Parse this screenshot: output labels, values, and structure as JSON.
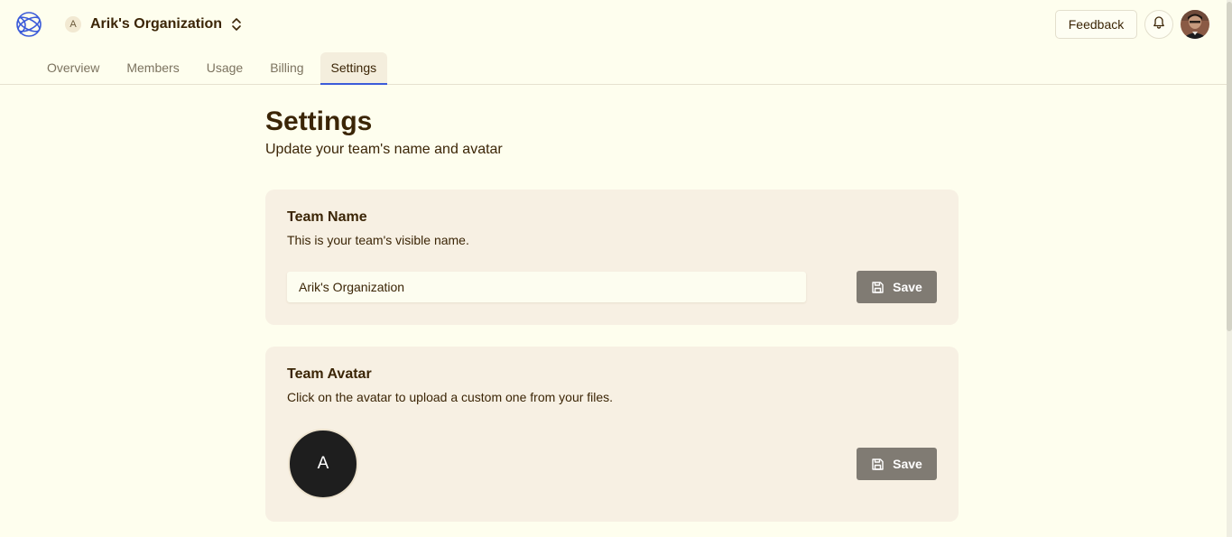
{
  "header": {
    "org_badge": "A",
    "org_name": "Arik's Organization",
    "feedback_label": "Feedback"
  },
  "tabs": [
    {
      "label": "Overview"
    },
    {
      "label": "Members"
    },
    {
      "label": "Usage"
    },
    {
      "label": "Billing"
    },
    {
      "label": "Settings"
    }
  ],
  "active_tab": "Settings",
  "page": {
    "title": "Settings",
    "subtitle": "Update your team's name and avatar"
  },
  "team_name_card": {
    "title": "Team Name",
    "description": "This is your team's visible name.",
    "input_value": "Arik's Organization",
    "save_label": "Save"
  },
  "team_avatar_card": {
    "title": "Team Avatar",
    "description": "Click on the avatar to upload a custom one from your files.",
    "avatar_letter": "A",
    "save_label": "Save"
  },
  "icons": {
    "logo": "globe-logo-icon",
    "org_switcher": "chevron-up-down-icon",
    "notifications": "bell-icon",
    "save": "floppy-disk-icon"
  },
  "colors": {
    "background": "#fefeee",
    "card": "#f7f0e3",
    "text": "#3b2506",
    "accent": "#3b5bd9",
    "save_button": "#807b73"
  }
}
